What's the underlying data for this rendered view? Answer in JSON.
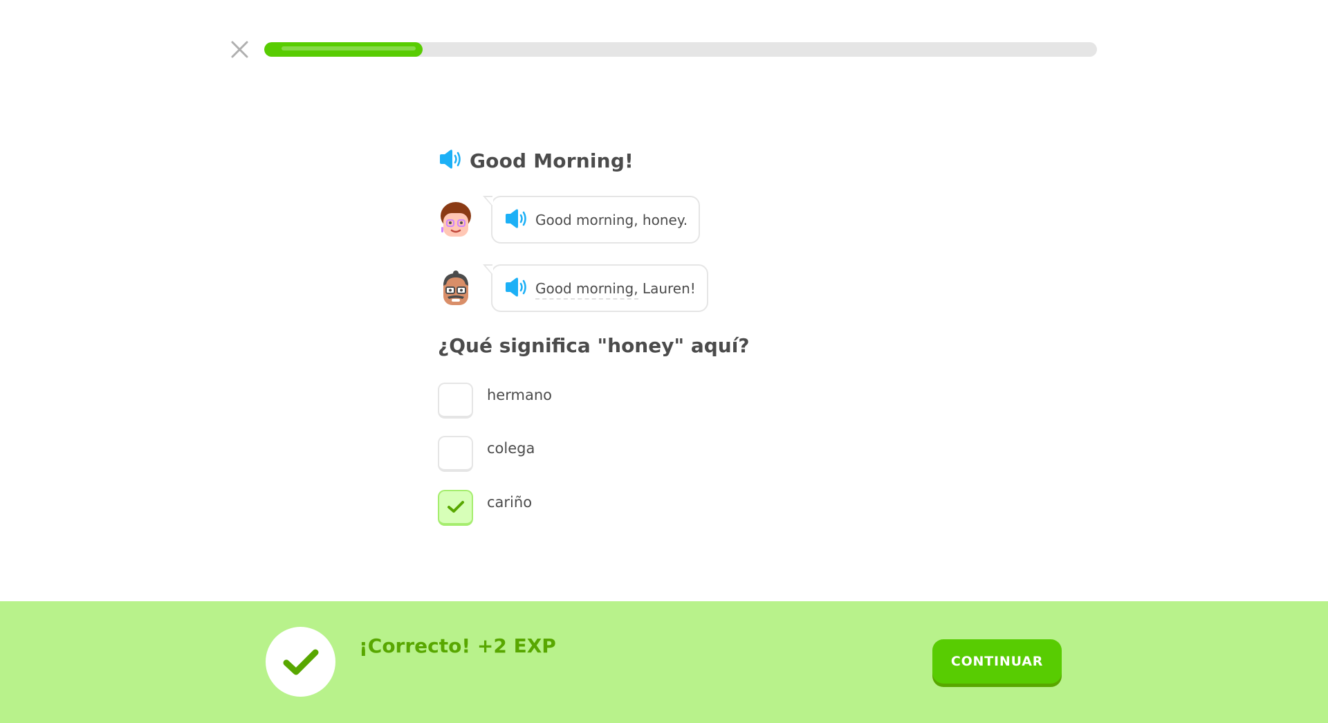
{
  "progress": {
    "fraction": 0.19
  },
  "lesson": {
    "title": "Good Morning!"
  },
  "dialog": [
    {
      "text": "Good morning, honey."
    },
    {
      "text_underlined": "Good morning,",
      "text_rest": " Lauren!"
    }
  ],
  "question": "¿Qué significa \"honey\" aquí?",
  "options": [
    {
      "label": "hermano",
      "checked": false
    },
    {
      "label": "colega",
      "checked": false
    },
    {
      "label": "cariño",
      "checked": true
    }
  ],
  "footer": {
    "result": "¡Correcto! +2 EXP",
    "continue_label": "CONTINUAR"
  },
  "colors": {
    "accent": "#58cc02",
    "accent_dark": "#58a700",
    "footer_bg": "#b8f28b",
    "speaker_blue": "#1cb0f6"
  },
  "icons": {
    "close": "close-icon",
    "speaker": "speaker-icon",
    "check": "check-icon"
  }
}
